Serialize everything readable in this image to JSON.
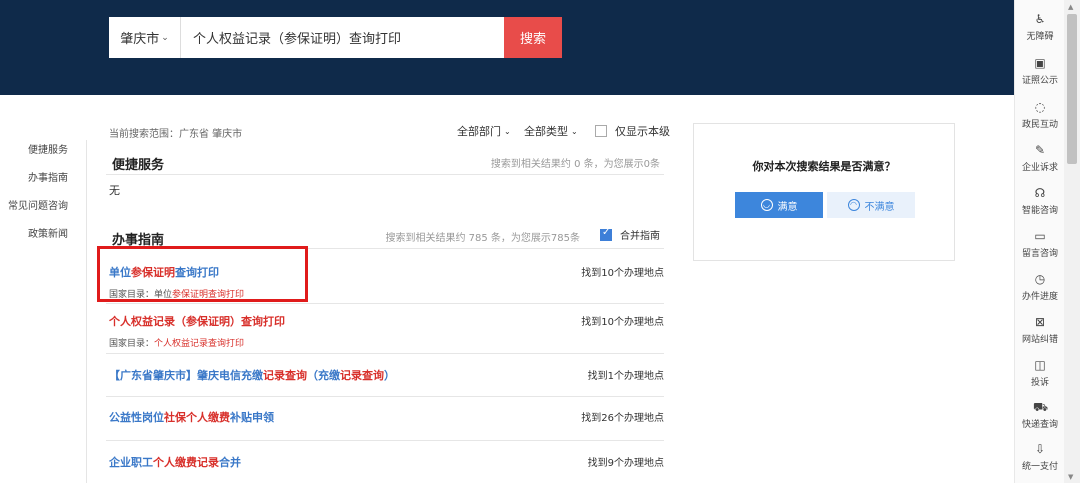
{
  "search": {
    "city": "肇庆市",
    "query": "个人权益记录（参保证明）查询打印",
    "button": "搜索"
  },
  "scope": "当前搜索范围：广东省 肇庆市",
  "filters": {
    "dept": "全部部门",
    "type": "全部类型",
    "local_only": "仅显示本级"
  },
  "left_nav": [
    "便捷服务",
    "办事指南",
    "常见问题咨询",
    "政策新闻"
  ],
  "sections": {
    "convenience": {
      "title": "便捷服务",
      "meta": "搜索到相关结果约 0 条，为您展示0条",
      "empty": "无"
    },
    "guide": {
      "title": "办事指南",
      "meta": "搜索到相关结果约 785 条，为您展示785条",
      "merge": "合并指南"
    }
  },
  "results": [
    {
      "parts": [
        [
          "单位",
          false
        ],
        [
          "参保证明",
          true
        ],
        [
          "查询打印",
          false
        ]
      ],
      "sub_prefix": "国家目录：单位",
      "sub_hl": "参保证明查询打印",
      "locations": "找到10个办理地点"
    },
    {
      "parts": [
        [
          "个人权益记录（参保证明）查询打印",
          true
        ]
      ],
      "sub_prefix": "国家目录：",
      "sub_hl": "个人权益记录查询打印",
      "locations": "找到10个办理地点"
    },
    {
      "parts": [
        [
          "【广东省肇庆市】肇庆电信充缴",
          false
        ],
        [
          "记录查询",
          true
        ],
        [
          "（充缴",
          false
        ],
        [
          "记录查询",
          true
        ],
        [
          "）",
          false
        ]
      ],
      "locations": "找到1个办理地点"
    },
    {
      "parts": [
        [
          "公益性岗位",
          false
        ],
        [
          "社保个人缴费",
          true
        ],
        [
          "补贴申领",
          false
        ]
      ],
      "locations": "找到26个办理地点"
    },
    {
      "parts": [
        [
          "企业职工",
          false
        ],
        [
          "个人缴费记录",
          true
        ],
        [
          "合并",
          false
        ]
      ],
      "locations": "找到9个办理地点"
    }
  ],
  "survey": {
    "question": "你对本次搜索结果是否满意？",
    "good": "满意",
    "bad": "不满意"
  },
  "right_rail": [
    {
      "icon": "accessibility-icon",
      "glyph": "♿",
      "label": "无障碍"
    },
    {
      "icon": "certificate-icon",
      "glyph": "▣",
      "label": "证照公示"
    },
    {
      "icon": "chat-icon",
      "glyph": "◌",
      "label": "政民互动"
    },
    {
      "icon": "pen-icon",
      "glyph": "✎",
      "label": "企业诉求"
    },
    {
      "icon": "headset-icon",
      "glyph": "☊",
      "label": "智能咨询"
    },
    {
      "icon": "message-icon",
      "glyph": "▭",
      "label": "留言咨询"
    },
    {
      "icon": "progress-icon",
      "glyph": "◷",
      "label": "办件进度"
    },
    {
      "icon": "error-report-icon",
      "glyph": "⊠",
      "label": "网站纠错"
    },
    {
      "icon": "complaint-icon",
      "glyph": "◫",
      "label": "投诉"
    },
    {
      "icon": "truck-icon",
      "glyph": "⛟",
      "label": "快递查询"
    },
    {
      "icon": "payment-icon",
      "glyph": "⇩",
      "label": "统一支付"
    }
  ],
  "colors": {
    "header_bg": "#0f2a4a",
    "search_button": "#e84c4a",
    "link_blue": "#3a78c8",
    "highlight_red": "#d8302b",
    "annotation_red": "#e01b1b"
  }
}
